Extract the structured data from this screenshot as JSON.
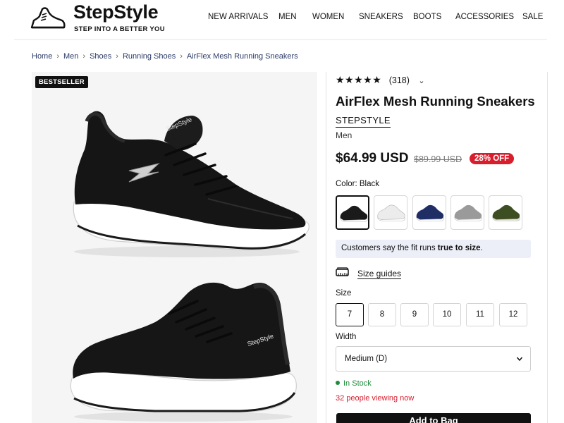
{
  "brand": {
    "name": "StepStyle",
    "tagline": "STEP INTO A BETTER YOU"
  },
  "nav": [
    "NEW ARRIVALS",
    "MEN",
    "WOMEN",
    "SNEAKERS",
    "BOOTS",
    "ACCESSORIES",
    "SALE"
  ],
  "breadcrumb": [
    "Home",
    "Men",
    "Shoes",
    "Running Shoes",
    "AirFlex Mesh Running Sneakers"
  ],
  "gallery": {
    "badge": "BESTSELLER",
    "shoe_logo_text": "StepStyle"
  },
  "product": {
    "rating_count": "(318)",
    "stars": "★★★★★",
    "title": "AirFlex Mesh Running Sneakers",
    "brand": "STEPSTYLE",
    "category": "Men",
    "price": "$64.99 USD",
    "compare_price": "$89.99 USD",
    "discount": "28% OFF",
    "color_label": "Color:",
    "color_value": "Black",
    "colors": [
      {
        "name": "Black",
        "hex": "#1a1a1a",
        "sole": "#ffffff"
      },
      {
        "name": "White",
        "hex": "#f2f2f2",
        "sole": "#ffffff"
      },
      {
        "name": "Navy",
        "hex": "#1f2f66",
        "sole": "#ffffff"
      },
      {
        "name": "Gray",
        "hex": "#9a9a9a",
        "sole": "#ffffff"
      },
      {
        "name": "Olive",
        "hex": "#3d4f22",
        "sole": "#e8e8e0"
      }
    ],
    "fit_note_prefix": "Customers say the fit runs",
    "fit_note_bold": "true to size",
    "size_guide": "Size guides",
    "size_label": "Size",
    "sizes": [
      "7",
      "8",
      "9",
      "10",
      "11",
      "12"
    ],
    "selected_size": "7",
    "width_label": "Width",
    "width_value": "Medium (D)",
    "stock": "In Stock",
    "viewers": "32 people viewing now",
    "add_to_cart": "Add to Bag"
  },
  "colors": {
    "accent_red": "#d81d2c",
    "stock_green": "#1f8c3c",
    "fit_bg": "#eceff8"
  }
}
